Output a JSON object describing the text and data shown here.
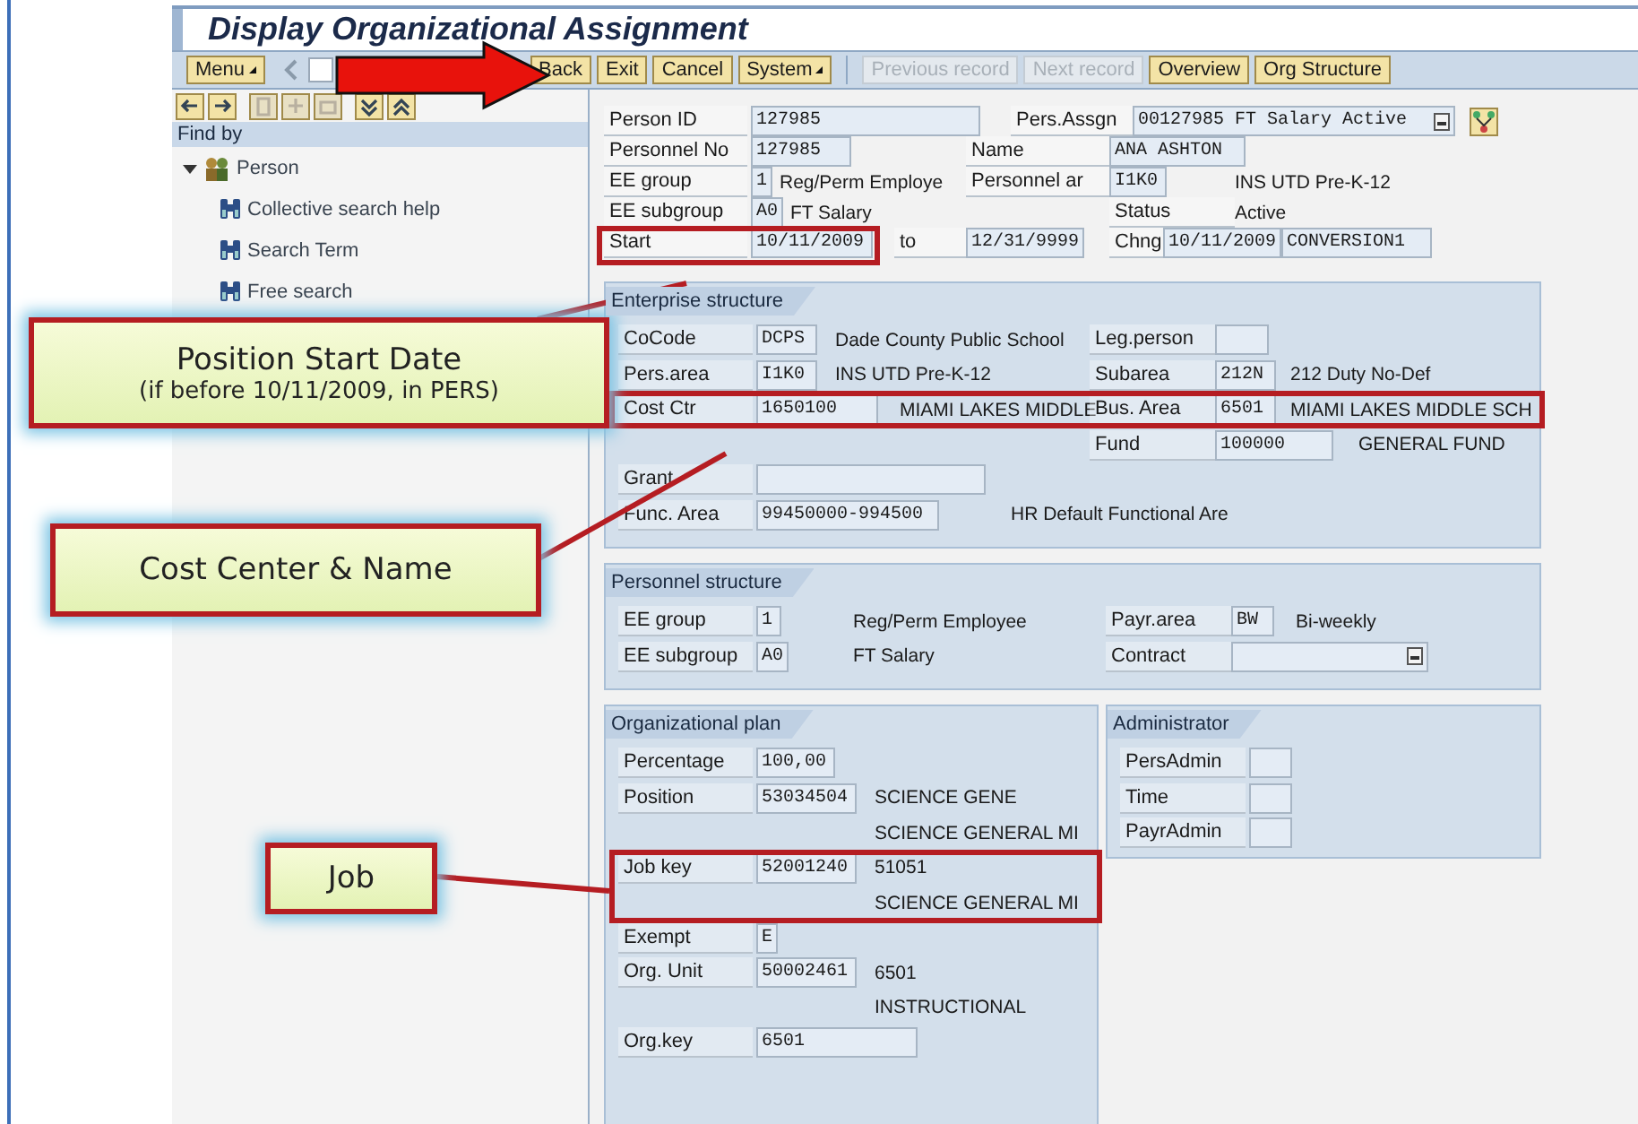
{
  "window": {
    "title": "Display Organizational Assignment"
  },
  "toolbar": {
    "menu": {
      "label": "Menu"
    },
    "buttons": [
      {
        "label": "Back",
        "kind": "button",
        "disabled": false
      },
      {
        "label": "Exit",
        "kind": "button",
        "disabled": false
      },
      {
        "label": "Cancel",
        "kind": "button",
        "disabled": false
      },
      {
        "label": "System",
        "kind": "menu",
        "disabled": false
      },
      {
        "kind": "separator"
      },
      {
        "label": "Previous record",
        "kind": "button",
        "disabled": true
      },
      {
        "label": "Next record",
        "kind": "button",
        "disabled": true
      },
      {
        "label": "Overview",
        "kind": "button",
        "disabled": false
      },
      {
        "label": "Org Structure",
        "kind": "button",
        "disabled": false
      }
    ]
  },
  "navigator": {
    "header": "Find by",
    "tree": [
      {
        "label": "Person",
        "expanded": true,
        "children": [
          {
            "label": "Collective search help"
          },
          {
            "label": "Search Term"
          },
          {
            "label": "Free search"
          }
        ]
      }
    ]
  },
  "header": {
    "rows": [
      [
        {
          "kind": "label",
          "text": "Person ID"
        },
        {
          "kind": "field",
          "value": "127985"
        },
        {
          "kind": "label",
          "text": "Pers.Assgn"
        },
        {
          "kind": "dropdown",
          "value": "00127985 FT Salary Active"
        },
        {
          "kind": "tree_button"
        }
      ],
      [
        {
          "kind": "label",
          "text": "Personnel No"
        },
        {
          "kind": "field",
          "value": "127985"
        },
        {
          "kind": "label",
          "text": "Name"
        },
        {
          "kind": "field",
          "value": "ANA ASHTON"
        }
      ],
      [
        {
          "kind": "label",
          "text": "EE group"
        },
        {
          "kind": "field",
          "value": "1"
        },
        {
          "kind": "text",
          "text": "Reg/Perm Employe"
        },
        {
          "kind": "label",
          "text": "Personnel ar"
        },
        {
          "kind": "field",
          "value": "I1K0"
        },
        {
          "kind": "text",
          "text": "INS UTD Pre-K-12"
        }
      ],
      [
        {
          "kind": "label",
          "text": "EE subgroup"
        },
        {
          "kind": "field",
          "value": "A0"
        },
        {
          "kind": "text",
          "text": "FT Salary"
        },
        "",
        {
          "kind": "label",
          "text": "Status"
        },
        {
          "kind": "text",
          "text": "Active"
        }
      ],
      [
        {
          "kind": "label",
          "text": "Start"
        },
        {
          "kind": "field",
          "value": "10/11/2009"
        },
        {
          "kind": "label",
          "text": "to"
        },
        {
          "kind": "field",
          "value": "12/31/9999"
        },
        {
          "kind": "label",
          "text": "Chng"
        },
        {
          "kind": "field",
          "value": "10/11/2009"
        },
        {
          "kind": "field",
          "value": "CONVERSION1"
        }
      ]
    ]
  },
  "sections": [
    {
      "title": "Enterprise structure",
      "rows": [
        [
          {
            "kind": "label",
            "text": "CoCode"
          },
          {
            "kind": "field",
            "value": "DCPS"
          },
          {
            "kind": "text",
            "text": "Dade County Public School"
          },
          {
            "kind": "label",
            "text": "Leg.person"
          },
          {
            "kind": "field"
          }
        ],
        [
          {
            "kind": "label",
            "text": "Pers.area"
          },
          {
            "kind": "field",
            "value": "I1K0"
          },
          {
            "kind": "text",
            "text": "INS UTD Pre-K-12"
          },
          {
            "kind": "label",
            "text": "Subarea"
          },
          {
            "kind": "field",
            "value": "212N"
          },
          {
            "kind": "text",
            "text": "212 Duty No-Def"
          }
        ],
        [
          {
            "kind": "label",
            "text": "Cost Ctr"
          },
          {
            "kind": "field",
            "value": "1650100"
          },
          {
            "kind": "text",
            "text": "MIAMI LAKES MIDDLE"
          },
          {
            "kind": "label",
            "text": "Bus. Area"
          },
          {
            "kind": "field",
            "value": "6501"
          },
          {
            "kind": "text",
            "text": "MIAMI LAKES MIDDLE SCH"
          }
        ],
        [
          "",
          "",
          "",
          {
            "kind": "label",
            "text": "Fund"
          },
          {
            "kind": "field",
            "value": "100000"
          },
          {
            "kind": "text",
            "text": "GENERAL FUND"
          }
        ],
        [
          {
            "kind": "label",
            "text": "Grant"
          },
          {
            "kind": "field"
          }
        ],
        [
          {
            "kind": "label",
            "text": "Func. Area"
          },
          {
            "kind": "field",
            "value": "99450000-994500"
          },
          {
            "kind": "text",
            "text": "HR Default Functional Are"
          }
        ]
      ]
    },
    {
      "title": "Personnel structure",
      "rows": [
        [
          {
            "kind": "label",
            "text": "EE group"
          },
          {
            "kind": "field",
            "value": "1"
          },
          {
            "kind": "text",
            "text": "Reg/Perm Employee"
          },
          {
            "kind": "label",
            "text": "Payr.area"
          },
          {
            "kind": "field",
            "value": "BW"
          },
          {
            "kind": "text",
            "text": "Bi-weekly"
          }
        ],
        [
          {
            "kind": "label",
            "text": "EE subgroup"
          },
          {
            "kind": "field",
            "value": "A0"
          },
          {
            "kind": "text",
            "text": "FT Salary"
          },
          {
            "kind": "label",
            "text": "Contract"
          },
          {
            "kind": "dropdown"
          }
        ]
      ]
    },
    {
      "title": "Organizational plan",
      "rows": [
        [
          {
            "kind": "label",
            "text": "Percentage"
          },
          {
            "kind": "field",
            "value": "100,00"
          }
        ],
        [
          {
            "kind": "label",
            "text": "Position"
          },
          {
            "kind": "field",
            "value": "53034504"
          },
          {
            "kind": "text",
            "text": "SCIENCE GENE"
          }
        ],
        [
          {
            "kind": "text",
            "text": "SCIENCE GENERAL MI"
          }
        ],
        [
          {
            "kind": "label",
            "text": "Job key"
          },
          {
            "kind": "field",
            "value": "52001240"
          },
          {
            "kind": "text",
            "text": "51051"
          }
        ],
        [
          {
            "kind": "text",
            "text": "SCIENCE GENERAL MI"
          }
        ],
        [
          {
            "kind": "label",
            "text": "Exempt"
          },
          {
            "kind": "field",
            "value": "E"
          }
        ],
        [
          {
            "kind": "label",
            "text": "Org. Unit"
          },
          {
            "kind": "field",
            "value": "50002461"
          },
          {
            "kind": "text",
            "text": "6501"
          }
        ],
        [
          {
            "kind": "text",
            "text": "INSTRUCTIONAL"
          }
        ],
        [
          {
            "kind": "label",
            "text": "Org.key"
          },
          {
            "kind": "field",
            "value": "6501"
          }
        ]
      ]
    },
    {
      "title": "Administrator",
      "rows": [
        [
          {
            "kind": "label",
            "text": "PersAdmin"
          },
          {
            "kind": "field"
          }
        ],
        [
          {
            "kind": "label",
            "text": "Time"
          },
          {
            "kind": "field"
          }
        ],
        [
          {
            "kind": "label",
            "text": "PayrAdmin"
          },
          {
            "kind": "field"
          }
        ]
      ]
    }
  ],
  "annotations": [
    {
      "title": "Position Start Date",
      "note": "(if before 10/11/2009, in PERS)"
    },
    {
      "title": "Cost Center & Name"
    },
    {
      "title": "Job"
    }
  ]
}
